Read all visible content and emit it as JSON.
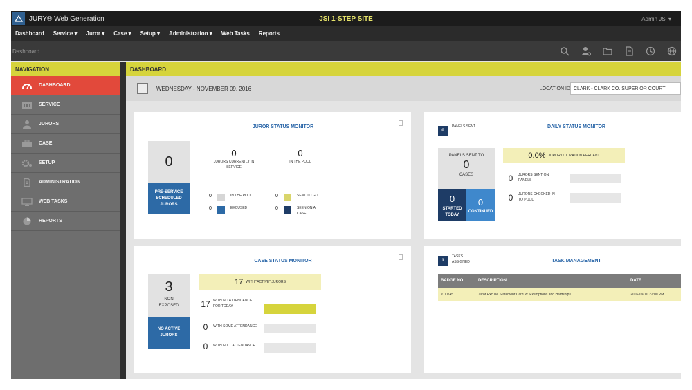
{
  "app": {
    "title": "JURY® Web Generation",
    "site": "JSI 1-STEP SITE",
    "user": "Admin JSI ▾"
  },
  "menu": [
    {
      "label": "Dashboard"
    },
    {
      "label": "Service ▾"
    },
    {
      "label": "Juror ▾"
    },
    {
      "label": "Case ▾"
    },
    {
      "label": "Setup ▾"
    },
    {
      "label": "Administration ▾"
    },
    {
      "label": "Web Tasks"
    },
    {
      "label": "Reports"
    }
  ],
  "breadcrumb": "Dashboard",
  "toolbar_icons": [
    "search-icon",
    "user-settings-icon",
    "folder-icon",
    "document-icon",
    "clock-icon",
    "globe-icon"
  ],
  "sidebar": {
    "header": "NAVIGATION",
    "items": [
      {
        "label": "DASHBOARD",
        "icon": "dashboard-gauge-icon"
      },
      {
        "label": "SERVICE",
        "icon": "building-icon"
      },
      {
        "label": "JURORS",
        "icon": "person-icon"
      },
      {
        "label": "CASE",
        "icon": "briefcase-icon"
      },
      {
        "label": "SETUP",
        "icon": "gears-icon"
      },
      {
        "label": "ADMINISTRATION",
        "icon": "document-icon"
      },
      {
        "label": "WEB TASKS",
        "icon": "monitor-icon"
      },
      {
        "label": "REPORTS",
        "icon": "pie-chart-icon"
      }
    ]
  },
  "dashboard": {
    "header": "DASHBOARD",
    "date": "WEDNESDAY - NOVEMBER 09, 2016",
    "location_label": "LOCATION ID",
    "location_value": "CLARK - CLARK CO. SUPERIOR COURT"
  },
  "juror_status": {
    "title": "JUROR STATUS MONITOR",
    "big_value": "0",
    "button": "PRE-SERVICE SCHEDULED JURORS",
    "stats": [
      {
        "value": "0",
        "label": "JURORS CURRENTLY IN SERVICE"
      },
      {
        "value": "0",
        "label": "IN THE POOL"
      }
    ],
    "legend": [
      {
        "value": "0",
        "label": "IN THE POOL",
        "color": "#d6d6d6"
      },
      {
        "value": "0",
        "label": "SENT TO GO",
        "color": "#d9d56b"
      },
      {
        "value": "0",
        "label": "EXCUSED",
        "color": "#2d6aa6"
      },
      {
        "value": "0",
        "label": "SEEN ON A CASE",
        "color": "#1e3c66"
      }
    ]
  },
  "daily_status": {
    "title": "DAILY STATUS MONITOR",
    "badge": "0",
    "badge_label": "PANELS SENT",
    "box_label": "PANELS SENT TO",
    "box_value": "0",
    "box_sub": "CASES",
    "buttons": [
      {
        "value": "0",
        "label": "STARTED TODAY"
      },
      {
        "value": "0",
        "label": "CONTINUED"
      }
    ],
    "percent": "0.0%",
    "percent_label": "JUROR UTILIZATION PERCENT",
    "rows": [
      {
        "value": "0",
        "label": "JURORS SENT ON PANELS"
      },
      {
        "value": "0",
        "label": "JURORS CHECKED IN TO POOL"
      }
    ]
  },
  "case_status": {
    "title": "CASE STATUS MONITOR",
    "big_value": "3",
    "big_label": "NON EXPOSED",
    "button": "NO ACTIVE JURORS",
    "summary_value": "17",
    "summary_label": "WITH \"ACTIVE\" JURORS",
    "rows": [
      {
        "value": "17",
        "label": "WITH NO ATTENDANCE FOR TODAY",
        "fill": 1.0
      },
      {
        "value": "0",
        "label": "WITH SOME ATTENDANCE",
        "fill": 0.0
      },
      {
        "value": "0",
        "label": "WITH FULL ATTENDANCE",
        "fill": 0.0
      }
    ]
  },
  "task_management": {
    "title": "TASK MANAGEMENT",
    "badge": "1",
    "badge_label": "TASKS ASSIGNED",
    "columns": [
      "BADGE NO",
      "DESCRIPTION",
      "DATE"
    ],
    "rows": [
      {
        "badge": "# 00745",
        "description": "Juror Excuse Statement Card W. Exemptions and Hardships",
        "date": "2016-09-10 22:00 PM"
      }
    ]
  },
  "colors": {
    "accent_yellow": "#d6d43c",
    "active_red": "#e2493b",
    "primary_blue": "#2d6aa6",
    "dark_navy": "#1e3c66"
  }
}
